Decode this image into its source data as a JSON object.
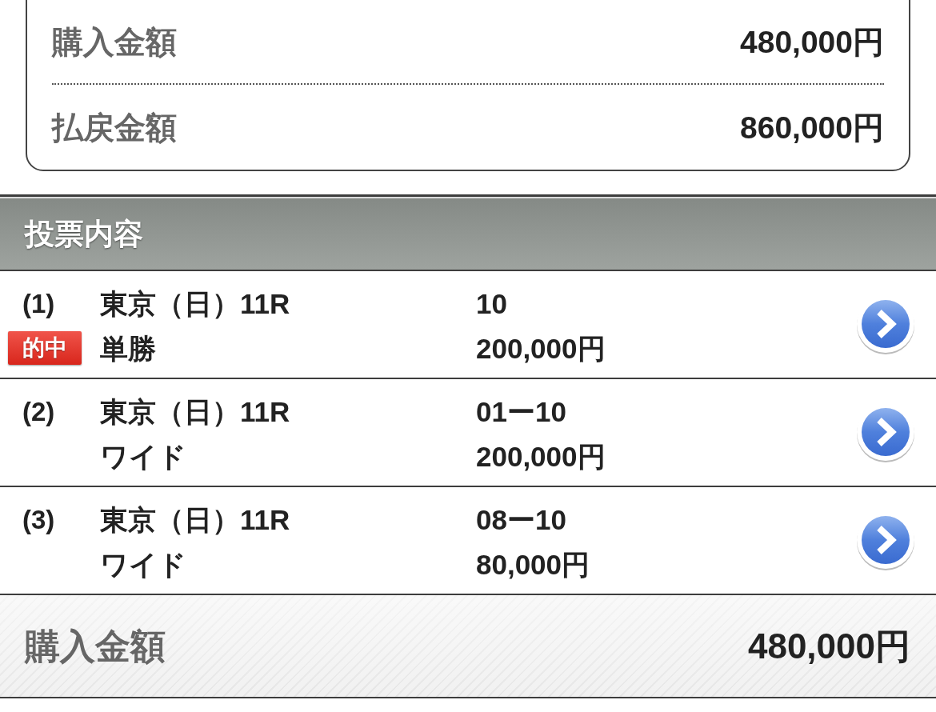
{
  "summary": {
    "rows": [
      {
        "label": "購入金額",
        "value": "480,000円"
      },
      {
        "label": "払戻金額",
        "value": "860,000円"
      }
    ]
  },
  "section": {
    "title": "投票内容"
  },
  "bets": [
    {
      "number": "(1)",
      "badge": "的中",
      "race": "東京（日）11R",
      "bet_type": "単勝",
      "selection": "10",
      "amount": "200,000円"
    },
    {
      "number": "(2)",
      "race": "東京（日）11R",
      "bet_type": "ワイド",
      "selection": "01ー10",
      "amount": "200,000円"
    },
    {
      "number": "(3)",
      "race": "東京（日）11R",
      "bet_type": "ワイド",
      "selection": "08ー10",
      "amount": "80,000円"
    }
  ],
  "total": {
    "label": "購入金額",
    "value": "480,000円"
  }
}
